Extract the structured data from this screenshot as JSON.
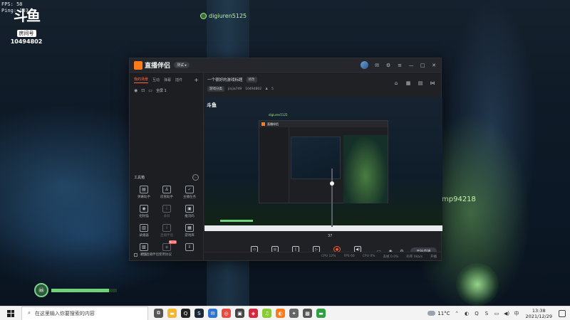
{
  "hud": {
    "fps_line": "FPS:    58",
    "ping_line": "Ping: 103"
  },
  "douyu": {
    "logo_text": "斗鱼",
    "room_label": "房间号",
    "room_number": "10494802"
  },
  "players": {
    "top_tag": "digiuren5125",
    "right_tag": "mp94218"
  },
  "health": {
    "fraction": 0.88,
    "color": "#6fd17a"
  },
  "app": {
    "brand": "直播伴侣",
    "version_badge": "测试 ▸",
    "left_tabs": [
      "我的场景",
      "互动",
      "弹幕",
      "插件"
    ],
    "scene_name": "全屏 1",
    "tools_title": "工具箱",
    "tools": [
      {
        "label": "弹幕助手",
        "icon": "▤",
        "dim": false,
        "new": ""
      },
      {
        "label": "房管助手",
        "icon": "♙",
        "dim": false,
        "new": ""
      },
      {
        "label": "主播任务",
        "icon": "✓",
        "dim": false,
        "new": ""
      },
      {
        "label": "招财猫",
        "icon": "◉",
        "dim": false,
        "new": ""
      },
      {
        "label": "录屏",
        "icon": "⇩",
        "dim": true,
        "new": ""
      },
      {
        "label": "推流码",
        "icon": "▣",
        "dim": false,
        "new": ""
      },
      {
        "label": "录播器",
        "icon": "▥",
        "dim": false,
        "new": ""
      },
      {
        "label": "直播伴侣",
        "icon": "⇩",
        "dim": true,
        "new": ""
      },
      {
        "label": "游戏库",
        "icon": "▦",
        "dim": false,
        "new": ""
      },
      {
        "label": "更多",
        "icon": "▧",
        "dim": false,
        "new": ""
      },
      {
        "label": "",
        "icon": "◈",
        "dim": true,
        "new": "NEW"
      },
      {
        "label": "",
        "icon": "⇩",
        "dim": false,
        "new": ""
      }
    ],
    "footer_text": "斗鱼直播伴侣使用协议",
    "stream_title": "一个很好的游戏标题",
    "edit_label": "修改",
    "category": "游戏分类",
    "streamer": "jinjia749",
    "room_id": "10494802",
    "viewers": "5",
    "preview_tag": "digiuren5125",
    "preview_logo": "斗鱼",
    "mic_level_value": "37",
    "mic_level_fraction": 0.74,
    "controls": [
      {
        "label": "直播画面",
        "icon": "▭",
        "mic": false
      },
      {
        "label": "摄像头",
        "icon": "◎",
        "mic": false
      },
      {
        "label": "手机投屏",
        "icon": "▯",
        "mic": false
      },
      {
        "label": "录屏框",
        "icon": "▷",
        "mic": false
      },
      {
        "label": "麦克风",
        "icon": "●",
        "mic": true
      },
      {
        "label": "扬声器",
        "icon": "◀)",
        "mic": false
      }
    ],
    "start_live_label": "开始直播",
    "status": [
      "CPU 12%",
      "FPS 60",
      "CPU 0%",
      "丢帧 0.0%",
      "码率 0kb/s",
      "开播"
    ]
  },
  "taskbar": {
    "search_placeholder": "在这里输入你要搜索的内容",
    "weather_temp": "11°C",
    "time": "13:38",
    "date": "2021/12/29",
    "apps": [
      {
        "name": "task-view-icon",
        "glyph": "⧉",
        "color": "#555"
      },
      {
        "name": "file-explorer-icon",
        "glyph": "▬",
        "color": "#f2b632"
      },
      {
        "name": "qq-icon",
        "glyph": "Q",
        "color": "#222"
      },
      {
        "name": "steam-icon",
        "glyph": "S",
        "color": "#1b2838"
      },
      {
        "name": "chat-icon",
        "glyph": "✉",
        "color": "#2f74d0"
      },
      {
        "name": "browser-icon",
        "glyph": "◎",
        "color": "#e94b3c"
      },
      {
        "name": "app-icon",
        "glyph": "▣",
        "color": "#444"
      },
      {
        "name": "game-icon",
        "glyph": "◈",
        "color": "#d7263d"
      },
      {
        "name": "music-icon",
        "glyph": "♫",
        "color": "#8c3"
      },
      {
        "name": "douyu-icon",
        "glyph": "◐",
        "color": "#ff7a1a"
      },
      {
        "name": "tool-icon",
        "glyph": "✦",
        "color": "#666"
      },
      {
        "name": "app2-icon",
        "glyph": "▩",
        "color": "#555"
      },
      {
        "name": "green-badge-icon",
        "glyph": "▬",
        "color": "#2ea043"
      }
    ]
  }
}
